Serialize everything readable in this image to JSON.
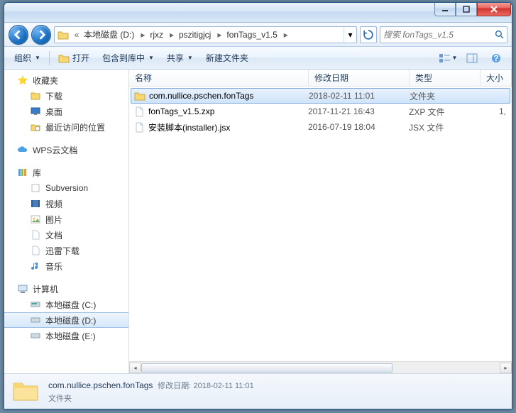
{
  "titlebar": {},
  "nav": {
    "crumbs": [
      "本地磁盘 (D:)",
      "rjxz",
      "pszitigjcj",
      "fonTags_v1.5"
    ],
    "search_placeholder": "搜索 fonTags_v1.5"
  },
  "toolbar": {
    "organize": "组织",
    "open": "打开",
    "include": "包含到库中",
    "share": "共享",
    "newfolder": "新建文件夹"
  },
  "sidebar": {
    "fav_label": "收藏夹",
    "fav": {
      "downloads": "下载",
      "desktop": "桌面",
      "recent": "最近访问的位置"
    },
    "wps": "WPS云文档",
    "lib_label": "库",
    "lib": {
      "subversion": "Subversion",
      "video": "视频",
      "pictures": "图片",
      "docs": "文档",
      "xl": "迅雷下载",
      "music": "音乐"
    },
    "comp_label": "计算机",
    "drives": {
      "c": "本地磁盘 (C:)",
      "d": "本地磁盘 (D:)",
      "e": "本地磁盘 (E:)"
    }
  },
  "columns": {
    "name": "名称",
    "date": "修改日期",
    "type": "类型",
    "size": "大小"
  },
  "files": [
    {
      "name": "com.nullice.pschen.fonTags",
      "date": "2018-02-11 11:01",
      "type": "文件夹",
      "size": "",
      "kind": "folder",
      "selected": true
    },
    {
      "name": "fonTags_v1.5.zxp",
      "date": "2017-11-21 16:43",
      "type": "ZXP 文件",
      "size": "1,",
      "kind": "file",
      "selected": false
    },
    {
      "name": "安装脚本(installer).jsx",
      "date": "2016-07-19 18:04",
      "type": "JSX 文件",
      "size": "",
      "kind": "file",
      "selected": false
    }
  ],
  "details": {
    "name": "com.nullice.pschen.fonTags",
    "meta_label": "修改日期:",
    "meta_value": "2018-02-11 11:01",
    "type": "文件夹"
  }
}
